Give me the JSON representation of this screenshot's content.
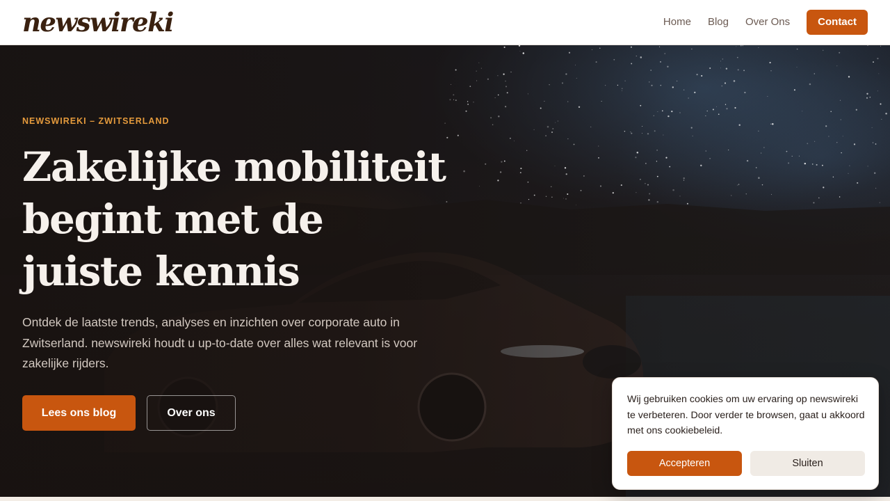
{
  "header": {
    "logo": "newswireki",
    "nav": {
      "home": "Home",
      "blog": "Blog",
      "about": "Over Ons",
      "contact": "Contact"
    }
  },
  "hero": {
    "eyebrow": "NEWSWIREKI – ZWITSERLAND",
    "title_lines": [
      "Zakelijke mobiliteit",
      "begint met de",
      "juiste kennis"
    ],
    "subtitle": "Ontdek de laatste trends, analyses en inzichten over corporate auto in Zwitserland. newswireki houdt u up-to-date over alles wat relevant is voor zakelijke rijders.",
    "primary_button": "Lees ons blog",
    "secondary_button": "Over ons"
  },
  "cookie_banner": {
    "text": "Wij gebruiken cookies om uw ervaring op newswireki te verbeteren. Door verder te browsen, gaat u akkoord met ons cookiebeleid.",
    "accept_label": "Accepteren",
    "close_label": "Sluiten"
  },
  "colors": {
    "accent": "#c8560f",
    "eyebrow": "#e49a3c",
    "logo": "#3a2110",
    "hero_bg": "#1d1918"
  }
}
